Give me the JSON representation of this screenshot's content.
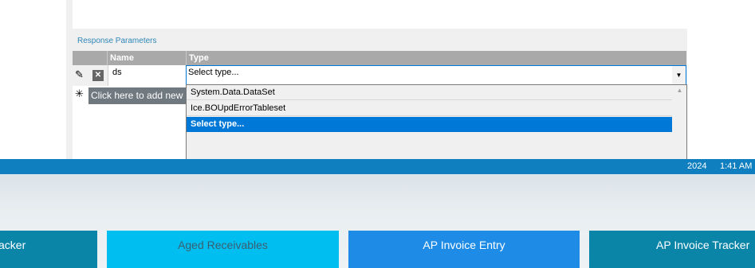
{
  "section": {
    "label": "Response Parameters"
  },
  "grid": {
    "headers": {
      "name": "Name",
      "type": "Type"
    },
    "row": {
      "name": "ds",
      "type_value": "Select type..."
    },
    "add_new_label": "Click here to add new p",
    "new_row_glyph": "✳",
    "edit_glyph": "✎",
    "delete_glyph": "✕"
  },
  "dropdown": {
    "options": [
      "System.Data.DataSet",
      "Ice.BOUpdErrorTableset",
      "Select type..."
    ],
    "selected_index": 2
  },
  "taskbar": {
    "date_fragment": "2024",
    "time": "1:41 AM"
  },
  "tiles": [
    {
      "label": "acker",
      "color": "#0a84a7"
    },
    {
      "label": "Aged Receivables",
      "color": "#00bff0"
    },
    {
      "label": "AP Invoice Entry",
      "color": "#1e8ce6"
    },
    {
      "label": "AP Invoice Tracker",
      "color": "#0a84a7"
    }
  ],
  "colors": {
    "accent": "#0078d7",
    "taskbar": "#0f7fc0",
    "header": "#a9a9a9"
  }
}
